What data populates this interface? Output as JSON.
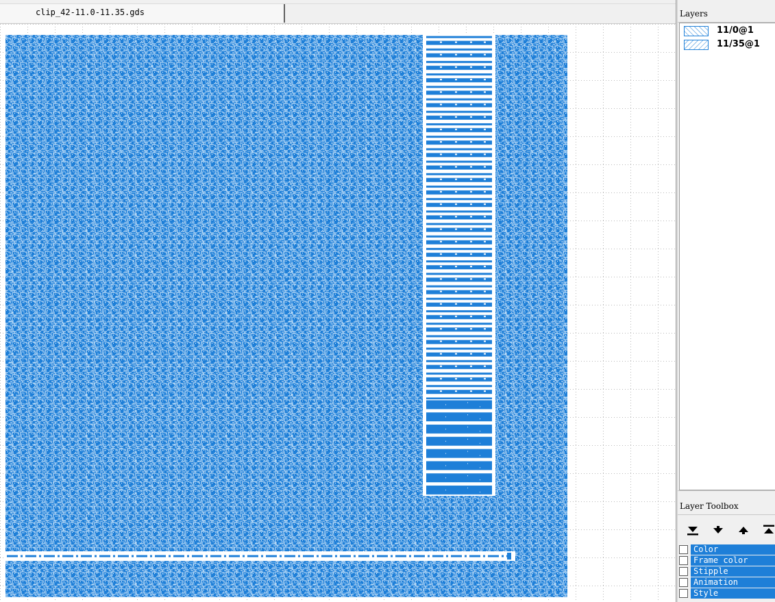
{
  "tab": {
    "title": "clip_42-11.0-11.35.gds"
  },
  "layers_panel": {
    "title": "Layers",
    "layers": [
      {
        "name": "11/0@1",
        "stipple": "diagonal-forward",
        "color": "#1e7fd8"
      },
      {
        "name": "11/35@1",
        "stipple": "diagonal-backward",
        "color": "#1e7fd8"
      }
    ]
  },
  "layer_toolbox": {
    "title": "Layer Toolbox",
    "buttons": [
      {
        "icon": "move-to-bottom-icon"
      },
      {
        "icon": "move-down-icon"
      },
      {
        "icon": "move-up-icon"
      },
      {
        "icon": "move-to-top-icon"
      }
    ],
    "properties": [
      {
        "label": "Color"
      },
      {
        "label": "Frame color"
      },
      {
        "label": "Stipple"
      },
      {
        "label": "Animation"
      },
      {
        "label": "Style"
      }
    ]
  },
  "colors": {
    "layout_fill": "#1e7fd8",
    "layout_pattern_light": "#4a9be6",
    "selection": "#1e7fd8",
    "grid_dot": "#b0b0b0"
  }
}
